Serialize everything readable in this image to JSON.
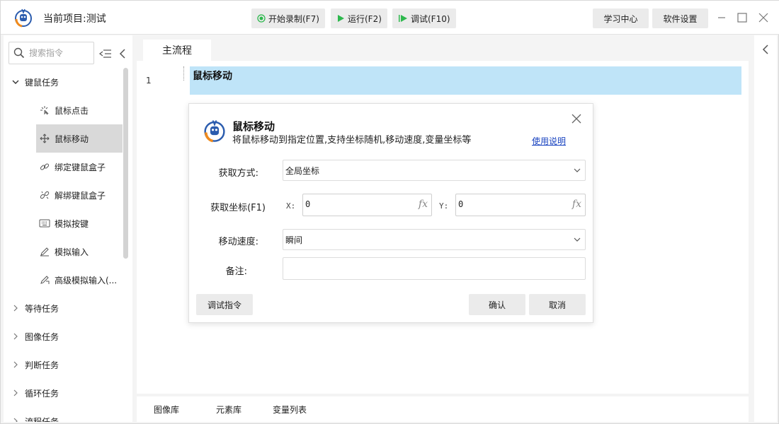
{
  "titlebar": {
    "project_title": "当前项目:测试",
    "record_label": "开始录制(F7)",
    "run_label": "运行(F2)",
    "debug_label": "调试(F10)",
    "learn_label": "学习中心",
    "settings_label": "软件设置"
  },
  "sidebar": {
    "search_placeholder": "搜索指令",
    "categories": [
      {
        "label": "键鼠任务",
        "expanded": true
      },
      {
        "label": "等待任务"
      },
      {
        "label": "图像任务"
      },
      {
        "label": "判断任务"
      },
      {
        "label": "循环任务"
      },
      {
        "label": "流程任务"
      }
    ],
    "items": [
      {
        "label": "鼠标点击",
        "icon": "mouse-click-icon"
      },
      {
        "label": "鼠标移动",
        "icon": "mouse-move-icon",
        "selected": true
      },
      {
        "label": "绑定键鼠盒子",
        "icon": "link-icon"
      },
      {
        "label": "解绑键鼠盒子",
        "icon": "unlink-icon"
      },
      {
        "label": "模拟按键",
        "icon": "keyboard-icon"
      },
      {
        "label": "模拟输入",
        "icon": "pen-icon"
      },
      {
        "label": "高级模拟输入(...",
        "icon": "advanced-pen-icon"
      }
    ]
  },
  "main": {
    "tab_label": "主流程",
    "steps": [
      {
        "line": "1",
        "label": "鼠标移动"
      }
    ]
  },
  "bottom_tabs": [
    "图像库",
    "元素库",
    "变量列表"
  ],
  "dialog": {
    "title": "鼠标移动",
    "description": "将鼠标移动到指定位置,支持坐标随机,移动速度,变量坐标等",
    "help_link": "使用说明",
    "acquire_mode_label": "获取方式:",
    "acquire_mode_value": "全局坐标",
    "coords_label": "获取坐标(F1)",
    "x_label": "X:",
    "x_value": "0",
    "y_label": "Y:",
    "y_value": "0",
    "fx_label": "fx",
    "speed_label": "移动速度:",
    "speed_value": "瞬间",
    "note_label": "备注:",
    "note_value": "",
    "debug_button": "调试指令",
    "confirm_button": "确认",
    "cancel_button": "取消"
  },
  "colors": {
    "selected_step_bg": "#bfe4f8",
    "link": "#1a44c0",
    "accent_green": "#2db84d"
  }
}
